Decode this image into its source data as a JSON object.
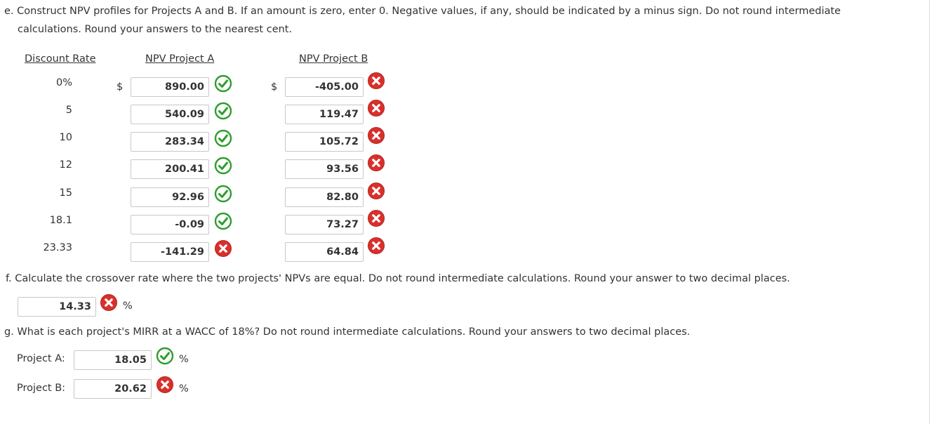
{
  "part_e": {
    "question": "e. Construct NPV profiles for Projects A and B. If an amount is zero, enter 0. Negative values, if any, should be indicated by a minus sign. Do not round intermediate",
    "question_cont": "calculations. Round your answers to the nearest cent.",
    "headers": {
      "rate": "Discount Rate",
      "a": "NPV Project A",
      "b": "NPV Project B"
    },
    "currency": "$",
    "rows": [
      {
        "rate": "0%",
        "a": "890.00",
        "a_status": "correct",
        "b": "-405.00",
        "b_status": "incorrect"
      },
      {
        "rate": "5",
        "a": "540.09",
        "a_status": "correct",
        "b": "119.47",
        "b_status": "incorrect"
      },
      {
        "rate": "10",
        "a": "283.34",
        "a_status": "correct",
        "b": "105.72",
        "b_status": "incorrect"
      },
      {
        "rate": "12",
        "a": "200.41",
        "a_status": "correct",
        "b": "93.56",
        "b_status": "incorrect"
      },
      {
        "rate": "15",
        "a": "92.96",
        "a_status": "correct",
        "b": "82.80",
        "b_status": "incorrect"
      },
      {
        "rate": "18.1",
        "a": "-0.09",
        "a_status": "correct",
        "b": "73.27",
        "b_status": "incorrect"
      },
      {
        "rate": "23.33",
        "a": "-141.29",
        "a_status": "incorrect",
        "b": "64.84",
        "b_status": "incorrect"
      }
    ]
  },
  "part_f": {
    "question": "f. Calculate the crossover rate where the two projects' NPVs are equal. Do not round intermediate calculations. Round your answer to two decimal places.",
    "value": "14.33",
    "status": "incorrect",
    "unit": "%"
  },
  "part_g": {
    "question": "g. What is each project's MIRR at a WACC of 18%? Do not round intermediate calculations. Round your answers to two decimal places.",
    "project_a": {
      "label": "Project A:",
      "value": "18.05",
      "status": "correct",
      "unit": "%"
    },
    "project_b": {
      "label": "Project B:",
      "value": "20.62",
      "status": "incorrect",
      "unit": "%"
    }
  },
  "icons": {
    "correct": "check-circle-icon",
    "incorrect": "x-circle-icon",
    "colors": {
      "correct": "#2e9e2e",
      "incorrect": "#d9302c"
    }
  }
}
